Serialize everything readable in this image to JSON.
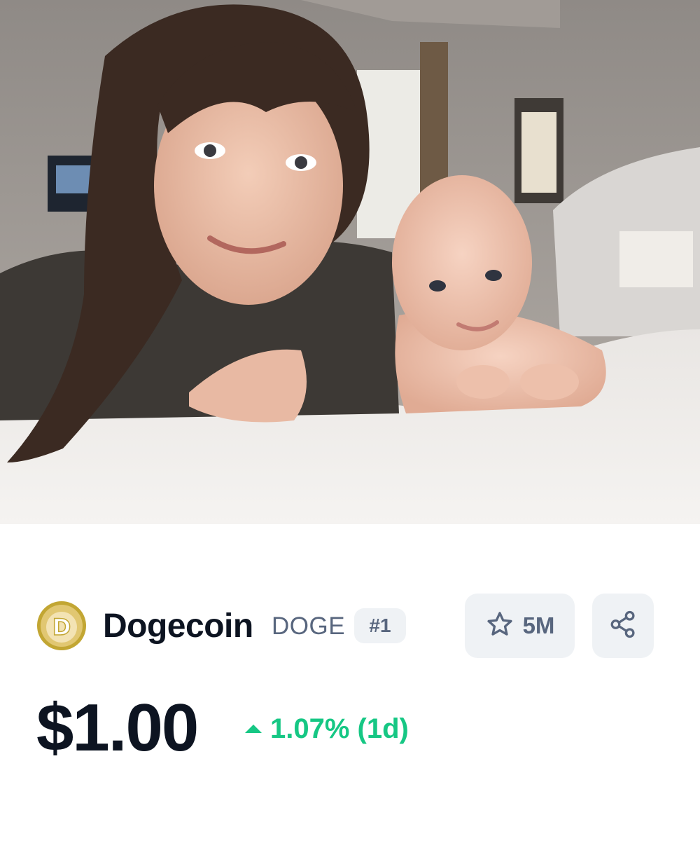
{
  "photo": {
    "description_icon": "selfie-photo"
  },
  "coin": {
    "name": "Dogecoin",
    "symbol": "DOGE",
    "rank": "#1",
    "logo_icon": "dogecoin-logo-icon"
  },
  "actions": {
    "watchlist_count": "5M",
    "watch_icon": "star-icon",
    "share_icon": "share-icon"
  },
  "price": {
    "value": "$1.00",
    "change": "1.07% (1d)",
    "direction": "up"
  },
  "colors": {
    "text_primary": "#0d1421",
    "text_secondary": "#58667e",
    "button_bg": "#eff2f5",
    "positive": "#16c784",
    "coin_gold": "#c2a633"
  }
}
